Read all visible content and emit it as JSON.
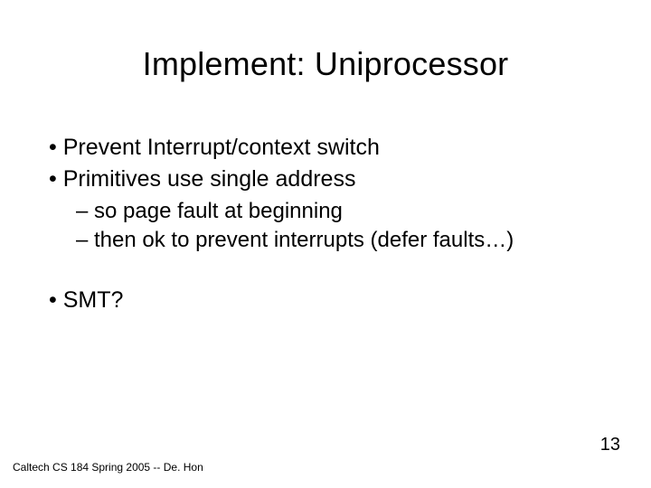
{
  "title": "Implement: Uniprocessor",
  "bullets": {
    "b1": "Prevent Interrupt/context switch",
    "b2": "Primitives use single address",
    "b2_sub1": "so page fault at beginning",
    "b2_sub2": "then ok to prevent interrupts (defer faults…)",
    "b3": "SMT?"
  },
  "footer": "Caltech CS 184 Spring 2005 -- De. Hon",
  "page_number": "13"
}
